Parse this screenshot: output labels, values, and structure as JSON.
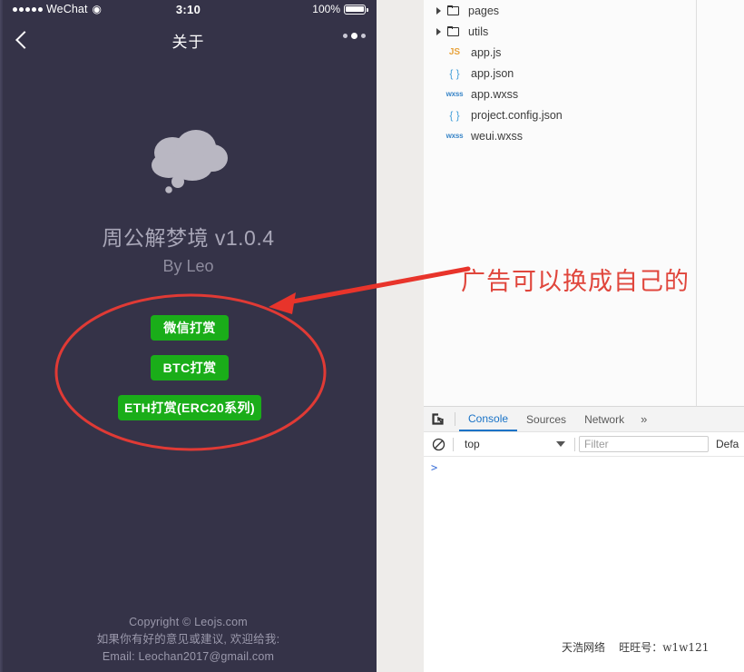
{
  "phone": {
    "status_bar": {
      "carrier": "WeChat",
      "wifi_icon": "wifi-icon",
      "time": "3:10",
      "battery_percent": "100%",
      "battery_icon": "battery-full-icon"
    },
    "nav": {
      "back_icon": "chevron-left-icon",
      "title": "关于",
      "more_icon": "more-dots-icon"
    },
    "logo": {
      "icon": "thought-cloud-icon",
      "color": "#b9b7c2"
    },
    "app_title": "周公解梦境 v1.0.4",
    "app_author": "By Leo",
    "buttons": [
      {
        "id": "wechat",
        "label": "微信打赏"
      },
      {
        "id": "btc",
        "label": "BTC打赏"
      },
      {
        "id": "eth",
        "label": "ETH打赏(ERC20系列)"
      }
    ],
    "button_color": "#1aad19",
    "footer": {
      "copyright": "Copyright © Leojs.com",
      "suggestion": "如果你有好的意见或建议, 欢迎给我:",
      "email": "Email: Leochan2017@gmail.com"
    },
    "background_color": "#353348"
  },
  "annotation": {
    "text": "广告可以换成自己的",
    "color": "#e0463c",
    "ellipse_name": "red-ellipse-highlight",
    "arrow_name": "red-arrow-pointer"
  },
  "file_tree": {
    "items": [
      {
        "name": "pages",
        "type": "folder",
        "icon": "folder-icon",
        "expander": "triangle-right-icon"
      },
      {
        "name": "utils",
        "type": "folder",
        "icon": "folder-icon",
        "expander": "triangle-right-icon"
      },
      {
        "name": "app.js",
        "type": "file",
        "icon": "js-file-icon",
        "badge": "JS"
      },
      {
        "name": "app.json",
        "type": "file",
        "icon": "json-file-icon",
        "badge": "{ }"
      },
      {
        "name": "app.wxss",
        "type": "file",
        "icon": "wxss-file-icon",
        "badge": "wxss"
      },
      {
        "name": "project.config.json",
        "type": "file",
        "icon": "json-file-icon",
        "badge": "{ }"
      },
      {
        "name": "weui.wxss",
        "type": "file",
        "icon": "wxss-file-icon",
        "badge": "wxss"
      }
    ]
  },
  "devtools": {
    "inspect_icon": "inspect-element-icon",
    "tabs": [
      {
        "label": "Console",
        "active": true
      },
      {
        "label": "Sources",
        "active": false
      },
      {
        "label": "Network",
        "active": false
      }
    ],
    "more_tabs_label": "»",
    "toolbar": {
      "clear_icon": "clear-console-icon",
      "context": "top",
      "filter_placeholder": "Filter",
      "filter_value": "",
      "levels_label": "Defa"
    },
    "console_prompt": ">"
  },
  "watermark": "天浩网络    旺旺号：w1w121"
}
